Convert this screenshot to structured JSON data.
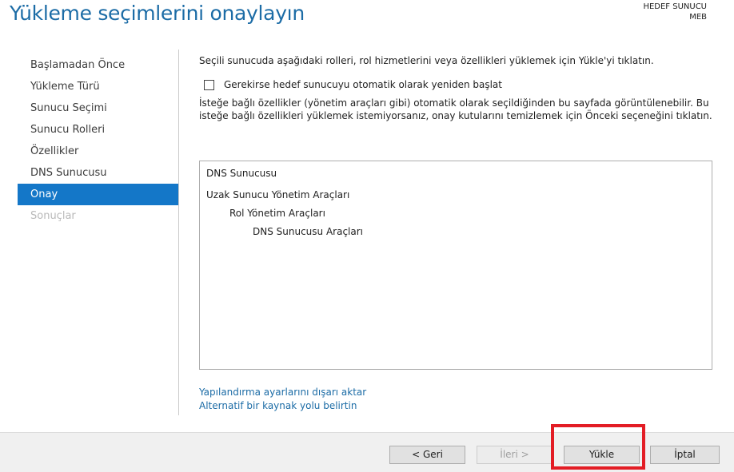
{
  "header": {
    "title": "Yükleme seçimlerini onaylayın",
    "target_label": "HEDEF SUNUCU",
    "target_server": "MEB"
  },
  "sidebar": {
    "items": [
      {
        "label": "Başlamadan Önce",
        "state": "normal"
      },
      {
        "label": "Yükleme Türü",
        "state": "normal"
      },
      {
        "label": "Sunucu Seçimi",
        "state": "normal"
      },
      {
        "label": "Sunucu Rolleri",
        "state": "normal"
      },
      {
        "label": "Özellikler",
        "state": "normal"
      },
      {
        "label": "DNS Sunucusu",
        "state": "normal"
      },
      {
        "label": "Onay",
        "state": "active"
      },
      {
        "label": "Sonuçlar",
        "state": "disabled"
      }
    ]
  },
  "main": {
    "intro": "Seçili sunucuda aşağıdaki rolleri, rol hizmetlerini veya özellikleri yüklemek için Yükle'yi tıklatın.",
    "restart_checkbox": {
      "label": "Gerekirse hedef sunucuyu otomatik olarak yeniden başlat",
      "checked": false
    },
    "info_text": "İsteğe bağlı özellikler (yönetim araçları gibi) otomatik olarak seçildiğinden bu sayfada görüntülenebilir. Bu isteğe bağlı özellikleri yüklemek istemiyorsanız, onay kutularını temizlemek için Önceki seçeneğini tıklatın.",
    "features": [
      {
        "label": "DNS Sunucusu",
        "level": 0
      },
      {
        "label": "Uzak Sunucu Yönetim Araçları",
        "level": 0
      },
      {
        "label": "Rol Yönetim Araçları",
        "level": 1
      },
      {
        "label": "DNS Sunucusu Araçları",
        "level": 2
      }
    ],
    "links": {
      "export": "Yapılandırma ayarlarını dışarı aktar",
      "alt_source": "Alternatif bir kaynak yolu belirtin"
    }
  },
  "footer": {
    "back": "< Geri",
    "next": "İleri >",
    "install": "Yükle",
    "cancel": "İptal"
  },
  "colors": {
    "title": "#1c6ca6",
    "active_nav": "#1477c8",
    "link": "#1c6ca6",
    "highlight": "#e31d25"
  }
}
